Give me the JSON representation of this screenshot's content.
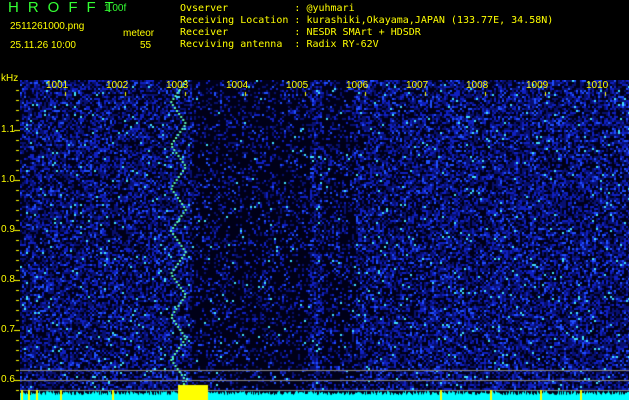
{
  "header": {
    "app_title": "HROFFT",
    "version": "1.00f",
    "filename": "2511261000.png",
    "datetime": "25.11.26 10:00",
    "meteor_label": "meteor",
    "meteor_count": "55"
  },
  "info": [
    {
      "label": "Ovserver",
      "value": "@yuhmari"
    },
    {
      "label": "Receiving Location",
      "value": "kurashiki,Okayama,JAPAN (133.77E, 34.58N)"
    },
    {
      "label": "Receiver",
      "value": "NESDR SMArt + HDSDR"
    },
    {
      "label": "Recviving antenna",
      "value": "Radix RY-62V"
    }
  ],
  "axis": {
    "unit": "kHz",
    "x_labels": [
      "1001",
      "1002",
      "1003",
      "1004",
      "1005",
      "1006",
      "1007",
      "1008",
      "1009",
      "1010"
    ],
    "y_labels": [
      "1.1",
      "1.0",
      "0.9",
      "0.8",
      "0.7",
      "0.6"
    ]
  },
  "colors": {
    "text": "#ffff00",
    "title": "#33ff33",
    "level": "#00ffff"
  }
}
